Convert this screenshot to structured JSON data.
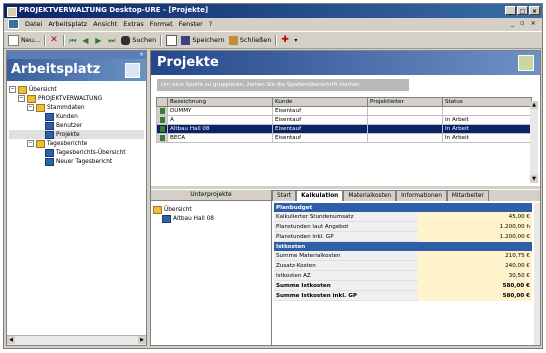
{
  "window": {
    "title": "PROJEKTVERWALTUNG Desktop-URE - [Projekte]",
    "buttons": [
      "_",
      "□",
      "×"
    ]
  },
  "menubar": {
    "items": [
      "Datei",
      "Arbeitsplatz",
      "Ansicht",
      "Extras",
      "Format",
      "Fenster",
      "?"
    ],
    "mdi_controls": "_ ▫ ×"
  },
  "toolbar": {
    "new_label": "Neu...",
    "search_label": "Suchen",
    "save_label": "Speichern",
    "children_label": "Schließen"
  },
  "left_panel": {
    "title": "Arbeitsplatz",
    "tree": [
      {
        "label": "Übersicht",
        "level": 0,
        "expander": "−",
        "icon": "folder"
      },
      {
        "label": "PROJEKTVERWALTUNG",
        "level": 1,
        "expander": "−",
        "icon": "folder"
      },
      {
        "label": "Stammdaten",
        "level": 2,
        "expander": "−",
        "icon": "folder"
      },
      {
        "label": "Kunden",
        "level": 3,
        "expander": "",
        "icon": "list"
      },
      {
        "label": "Benutzer",
        "level": 3,
        "expander": "",
        "icon": "list"
      },
      {
        "label": "Projekte",
        "level": 3,
        "expander": "",
        "icon": "list",
        "selected": true
      },
      {
        "label": "Tagesberichte",
        "level": 2,
        "expander": "−",
        "icon": "folder"
      },
      {
        "label": "Tagesberichts-Übersicht",
        "level": 3,
        "expander": "",
        "icon": "list"
      },
      {
        "label": "Neuer Tagesbericht",
        "level": 3,
        "expander": "",
        "icon": "list"
      }
    ]
  },
  "right_panel": {
    "title": "Projekte",
    "group_hint": "Um eine Spalte zu gruppieren, ziehen Sie die Spaltenüberschrift hierher.",
    "columns": [
      "Bezeichnung",
      "Kunde",
      "Projektleiter",
      "Status"
    ],
    "rows": [
      {
        "cells": [
          "DUMMY",
          "Eisentauf",
          "",
          ""
        ],
        "selected": false
      },
      {
        "cells": [
          "A",
          "Eisentauf",
          "",
          "In Arbeit"
        ],
        "selected": false
      },
      {
        "cells": [
          "Altbau Hall 08",
          "Eisentauf",
          "",
          "In Arbeit"
        ],
        "selected": true
      },
      {
        "cells": [
          "BECA",
          "Eisentauf",
          "",
          "In Arbeit"
        ],
        "selected": false
      }
    ],
    "lower_left": {
      "header": "Unterprojekte",
      "tree": [
        {
          "label": "Übersicht",
          "icon": "folder"
        },
        {
          "label": "Altbau Hall 08",
          "icon": "item"
        }
      ]
    },
    "tabs": [
      "Start",
      "Kalkulation",
      "Materialkosten",
      "Informationen",
      "Mitarbeiter"
    ],
    "active_tab": 1,
    "props": [
      {
        "type": "section",
        "label": "Planbudget"
      },
      {
        "type": "row",
        "label": "Kalkulierter Stundenumsatz",
        "value": "45,00 €"
      },
      {
        "type": "row",
        "label": "Planstunden laut Angebot",
        "value": "1.200,00 h"
      },
      {
        "type": "row",
        "label": "Planstunden inkl. GP",
        "value": "1.200,00 €"
      },
      {
        "type": "section",
        "label": "Istkosten"
      },
      {
        "type": "row",
        "label": "Summe Materialkosten",
        "value": "210,75 €"
      },
      {
        "type": "row",
        "label": "Zusatz-Kosten",
        "value": "240,00 €"
      },
      {
        "type": "row",
        "label": "Istkosten AZ",
        "value": "30,50 €"
      },
      {
        "type": "bold",
        "label": "Summe Istkosten",
        "value": "580,00 €"
      },
      {
        "type": "bold",
        "label": "Summe Istkosten inkl. GP",
        "value": "580,00 €"
      }
    ]
  },
  "colors": {
    "titlebar": "#0a246a",
    "panel_header": "#3a5f9a",
    "selection": "#0a246a",
    "section_header": "#2f5fa8",
    "value_highlight": "#fff3cc"
  }
}
